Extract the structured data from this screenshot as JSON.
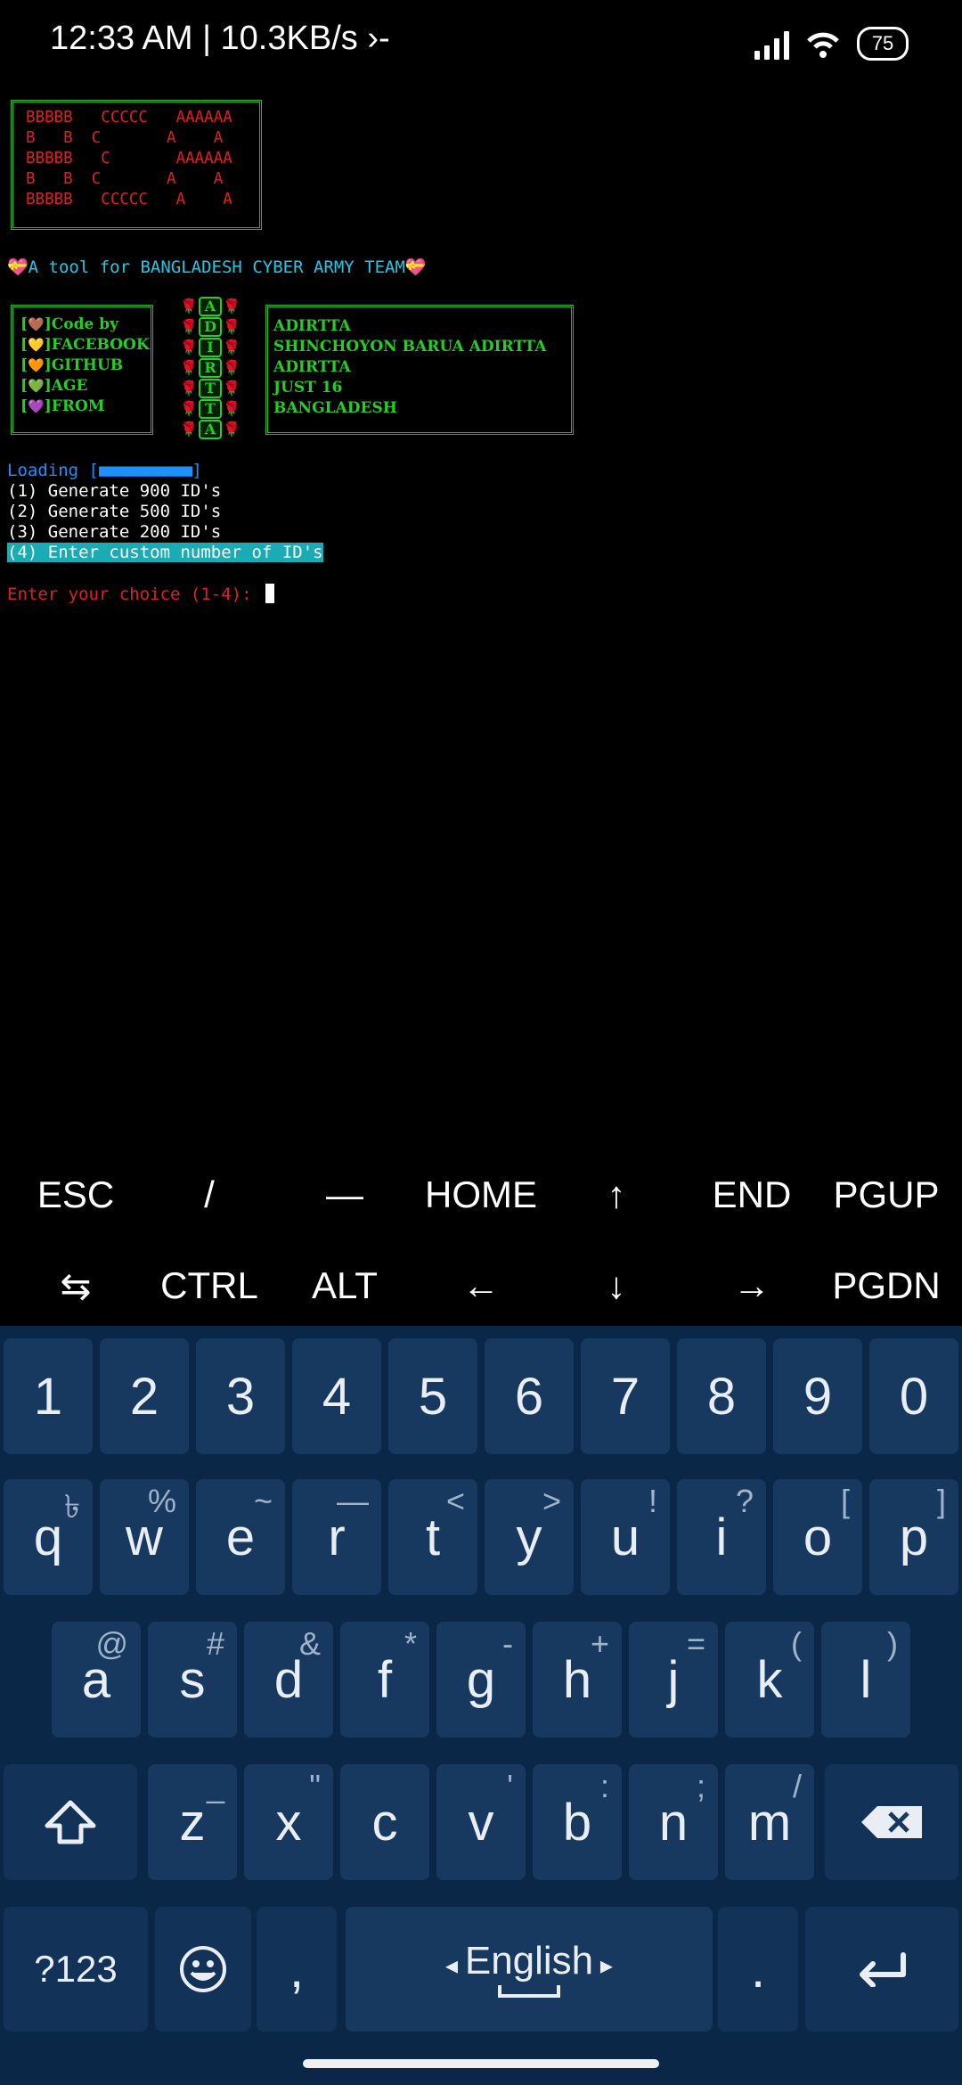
{
  "status_bar": {
    "time_speed": "12:33 AM | 10.3KB/s",
    "terminal_glyph": "›-",
    "battery": "75"
  },
  "terminal": {
    "banner_lines": [
      "BBBBB   CCCCC   AAAAAA",
      "B   B  C       A    A",
      "BBBBB   C       AAAAAA",
      "B   B  C       A    A",
      "BBBBB   CCCCC   A    A"
    ],
    "tagline": "💝A tool for BANGLADESH CYBER ARMY TEAM💝",
    "info_labels": [
      "Code by",
      "FACEBOOK",
      "GITHUB",
      "AGE",
      "FROM"
    ],
    "info_hearts": [
      "🤎",
      "💛",
      "🧡",
      "💚",
      "💜"
    ],
    "name_letters": [
      "A",
      "D",
      "I",
      "R",
      "T",
      "T",
      "A"
    ],
    "info_values": [
      "ADIRTTA",
      "SHINCHOYON BARUA ADIRTTA",
      "ADIRTTA",
      "JUST 16",
      "BANGLADESH"
    ],
    "loading_label": "Loading [",
    "loading_bar": "■■■■■■■■■■",
    "loading_end": "]",
    "options": [
      "(1) Generate 900 ID's",
      "(2) Generate 500 ID's",
      "(3) Generate 200 ID's",
      "(4) Enter custom number of ID's"
    ],
    "prompt": "Enter your choice (1-4): "
  },
  "extra_keys": {
    "row1": [
      "ESC",
      "/",
      "—",
      "HOME",
      "↑",
      "END",
      "PGUP"
    ],
    "row2": [
      "⇆",
      "CTRL",
      "ALT",
      "←",
      "↓",
      "→",
      "PGDN"
    ]
  },
  "keyboard": {
    "numbers": [
      "1",
      "2",
      "3",
      "4",
      "5",
      "6",
      "7",
      "8",
      "9",
      "0"
    ],
    "row_q": [
      [
        "q",
        "৳"
      ],
      [
        "w",
        "%"
      ],
      [
        "e",
        "~"
      ],
      [
        "r",
        "—"
      ],
      [
        "t",
        "<"
      ],
      [
        "y",
        ">"
      ],
      [
        "u",
        "!"
      ],
      [
        "i",
        "?"
      ],
      [
        "o",
        "["
      ],
      [
        "p",
        "]"
      ]
    ],
    "row_a": [
      [
        "a",
        "@"
      ],
      [
        "s",
        "#"
      ],
      [
        "d",
        "&"
      ],
      [
        "f",
        "*"
      ],
      [
        "g",
        "-"
      ],
      [
        "h",
        "+"
      ],
      [
        "j",
        "="
      ],
      [
        "k",
        "("
      ],
      [
        "l",
        ")"
      ]
    ],
    "row_z": [
      [
        "z",
        "_"
      ],
      [
        "x",
        "\""
      ],
      [
        "c",
        ""
      ],
      [
        "v",
        "'"
      ],
      [
        "b",
        ":"
      ],
      [
        "n",
        ";"
      ],
      [
        "m",
        "/"
      ]
    ],
    "symbols_key": "?123",
    "comma": ",",
    "language": "English",
    "period": ".",
    "colors": {
      "keyboard_bg": "#0b2747",
      "key_bg": "#17395f"
    }
  }
}
